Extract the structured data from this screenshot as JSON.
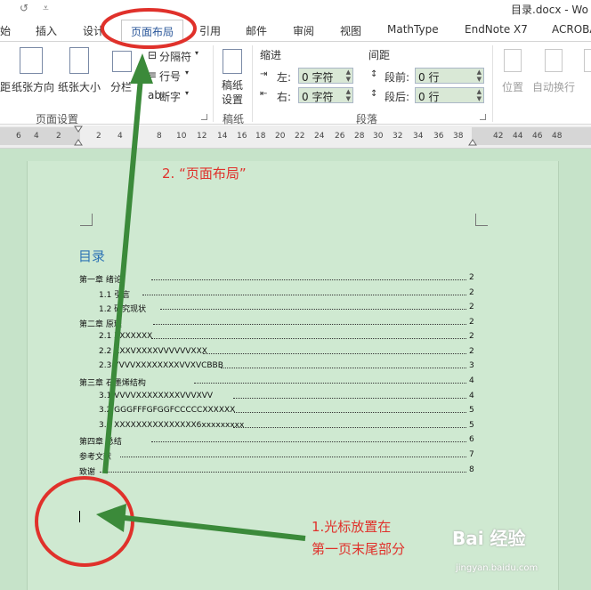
{
  "titlebar": {
    "title": "目录.docx - Wo",
    "undo": "↺",
    "customize": "⩡"
  },
  "tabs": {
    "start": "始",
    "insert": "插入",
    "design": "设计",
    "layout": "页面布局",
    "references": "引用",
    "mailings": "邮件",
    "review": "审阅",
    "view": "视图",
    "mathtype": "MathType",
    "endnote": "EndNote X7",
    "acrobat": "ACROBA"
  },
  "ribbon": {
    "margins_label": "距",
    "orientation_label": "纸张方向",
    "size_label": "纸张大小",
    "columns_label": "分栏",
    "breaks_label": "分隔符",
    "line_numbers_label": "行号",
    "hyphenation_label": "断字",
    "page_setup_group": "页面设置",
    "draft_label_1": "稿纸",
    "draft_label_2": "设置",
    "draft_group": "稿纸",
    "indent_header": "缩进",
    "spacing_header": "间距",
    "indent_left_label": "左:",
    "indent_right_label": "右:",
    "indent_left_value": "0 字符",
    "indent_right_value": "0 字符",
    "spacing_before_label": "段前:",
    "spacing_after_label": "段后:",
    "spacing_before_value": "0 行",
    "spacing_after_value": "0 行",
    "paragraph_group": "段落",
    "position_label": "位置",
    "wrap_label": "自动换行"
  },
  "ruler": {
    "ticks": [
      "6",
      "4",
      "2",
      "2",
      "4",
      "8",
      "10",
      "12",
      "14",
      "16",
      "18",
      "20",
      "22",
      "24",
      "26",
      "28",
      "30",
      "32",
      "34",
      "36",
      "38",
      "42",
      "44",
      "46",
      "48"
    ]
  },
  "document": {
    "toc_title": "目录",
    "entries": [
      {
        "label": "第一章        绪论",
        "page": "2"
      },
      {
        "label": "1.1 引言",
        "page": "2"
      },
      {
        "label": "1.2 研究现状",
        "page": "2"
      },
      {
        "label": "第二章        原理",
        "page": "2"
      },
      {
        "label": "2.1 XXXXXXX",
        "page": "2"
      },
      {
        "label": "2.2 XXXVXXXXVVVVVVXXX",
        "page": "2"
      },
      {
        "label": "2.3 YVVVXXXXXXXXVVXVCBBB",
        "page": "3"
      },
      {
        "label": "第三章        石墨烯结构",
        "page": "4"
      },
      {
        "label": "3.1 VVVVXXXXXXXXVVVXVV",
        "page": "4"
      },
      {
        "label": "3.2 GGGFFFGFGGFCCCCCXXXXXX",
        "page": "5"
      },
      {
        "label": "3.3 XXXXXXXXXXXXXXX6xxxxxxxxx",
        "page": "5"
      },
      {
        "label": "第四章        总结",
        "page": "6"
      },
      {
        "label": "参考文献",
        "page": "7"
      },
      {
        "label": "致谢",
        "page": "8"
      }
    ]
  },
  "annotations": {
    "step2": "2. “页面布局”",
    "step1_line1": "1.光标放置在",
    "step1_line2": "第一页末尾部分",
    "color": "#e0312b",
    "arrow_color": "#3b8a3a"
  },
  "watermark": {
    "brand": "Bai 经验",
    "url": "jingyan.baidu.com"
  }
}
